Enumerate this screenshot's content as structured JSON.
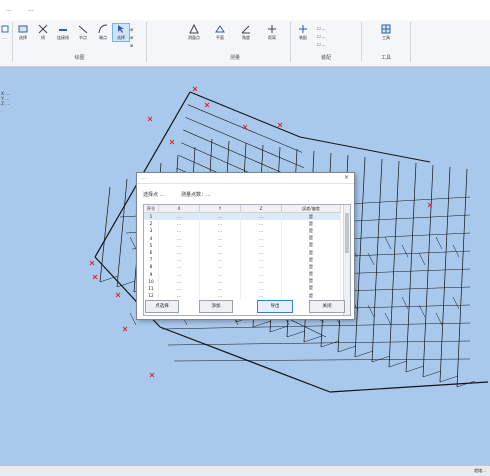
{
  "menubar": {
    "items": [
      "...",
      "..."
    ]
  },
  "ribbon": {
    "groups": [
      {
        "caption": "",
        "tools": [
          "..."
        ]
      },
      {
        "caption": "绘图",
        "tools": [
          "选择",
          "线",
          "连接线",
          "节点",
          "端点",
          "选择"
        ]
      },
      {
        "caption": "测量",
        "tools": [
          "测量点",
          "平面",
          "角度",
          "距离"
        ]
      },
      {
        "caption": "装配",
        "tools": [
          "装配"
        ]
      },
      {
        "caption": "工具",
        "tools": [
          "工具"
        ]
      }
    ]
  },
  "viewport": {
    "coord_text": [
      "X: ...",
      "Y: ...",
      "Z: ..."
    ]
  },
  "dialog": {
    "title": "...",
    "info_left": "选择点 ...",
    "info_right": "测量点数：...",
    "columns": [
      "序号",
      "X",
      "Y",
      "Z",
      "误差/偏差"
    ],
    "rows": [
      [
        "1",
        "...",
        "...",
        "...",
        "是"
      ],
      [
        "2",
        "...",
        "...",
        "...",
        "是"
      ],
      [
        "3",
        "...",
        "...",
        "...",
        "是"
      ],
      [
        "4",
        "...",
        "...",
        "...",
        "是"
      ],
      [
        "5",
        "...",
        "...",
        "...",
        "是"
      ],
      [
        "6",
        "...",
        "...",
        "...",
        "是"
      ],
      [
        "7",
        "...",
        "...",
        "...",
        "是"
      ],
      [
        "8",
        "...",
        "...",
        "...",
        "是"
      ],
      [
        "9",
        "...",
        "...",
        "...",
        "是"
      ],
      [
        "10",
        "...",
        "...",
        "...",
        "是"
      ],
      [
        "11",
        "...",
        "...",
        "...",
        "是"
      ],
      [
        "12",
        "...",
        "...",
        "...",
        "是"
      ]
    ],
    "buttons": {
      "select": "点选择",
      "add": "添加",
      "export": "导出",
      "close": "关闭"
    }
  },
  "status": {
    "text": "就绪..."
  },
  "colors": {
    "background": "#a9c9ec",
    "model": "#141414",
    "marker": "#e02020",
    "selection": "#3d7bd1"
  }
}
